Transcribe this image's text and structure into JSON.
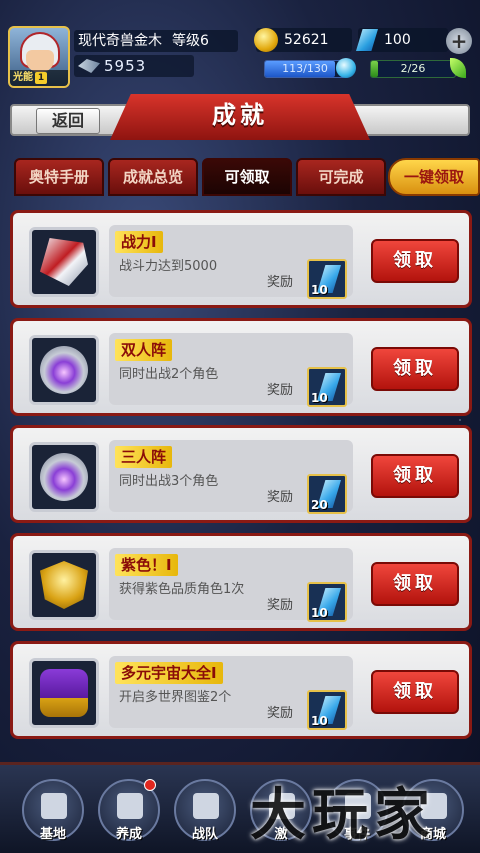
{
  "player": {
    "name": "现代奇兽金木",
    "level_text": "等级6",
    "avatar_badge": "光能",
    "avatar_badge_level": "1",
    "power": "5953"
  },
  "resources": {
    "gold": "52621",
    "diamond": "100",
    "energy_text": "113/130",
    "energy_fraction": 0.87,
    "stamina_text": "2/26",
    "stamina_fraction": 0.08
  },
  "header": {
    "title": "成就",
    "back_label": "返回"
  },
  "tabs": [
    {
      "label": "奥特手册"
    },
    {
      "label": "成就总览"
    },
    {
      "label": "可领取"
    },
    {
      "label": "可完成"
    },
    {
      "label": "一键领取"
    }
  ],
  "achievements": [
    {
      "title": "战力I",
      "desc": "战斗力达到5000",
      "reward_label": "奖励",
      "reward_count": "10",
      "claim_label": "领取",
      "icon": "shield-icon"
    },
    {
      "title": "双人阵",
      "desc": "同时出战2个角色",
      "reward_label": "奖励",
      "reward_count": "10",
      "claim_label": "领取",
      "icon": "fist-icon"
    },
    {
      "title": "三人阵",
      "desc": "同时出战3个角色",
      "reward_label": "奖励",
      "reward_count": "20",
      "claim_label": "领取",
      "icon": "fist-icon"
    },
    {
      "title": "紫色！I",
      "desc": "获得紫色品质角色1次",
      "reward_label": "奖励",
      "reward_count": "10",
      "claim_label": "领取",
      "icon": "medal-icon"
    },
    {
      "title": "多元宇宙大全I",
      "desc": "开启多世界图鉴2个",
      "reward_label": "奖励",
      "reward_count": "10",
      "claim_label": "领取",
      "icon": "book-icon"
    }
  ],
  "nav": [
    {
      "label": "基地",
      "icon": "base-icon"
    },
    {
      "label": "养成",
      "icon": "trophy-icon",
      "has_dot": true
    },
    {
      "label": "战队",
      "icon": "cards-icon"
    },
    {
      "label": "激",
      "icon": "boss-icon"
    },
    {
      "label": "事件",
      "icon": "event-icon"
    },
    {
      "label": "商城",
      "icon": "shop-icon"
    }
  ],
  "watermark": "大玩家"
}
